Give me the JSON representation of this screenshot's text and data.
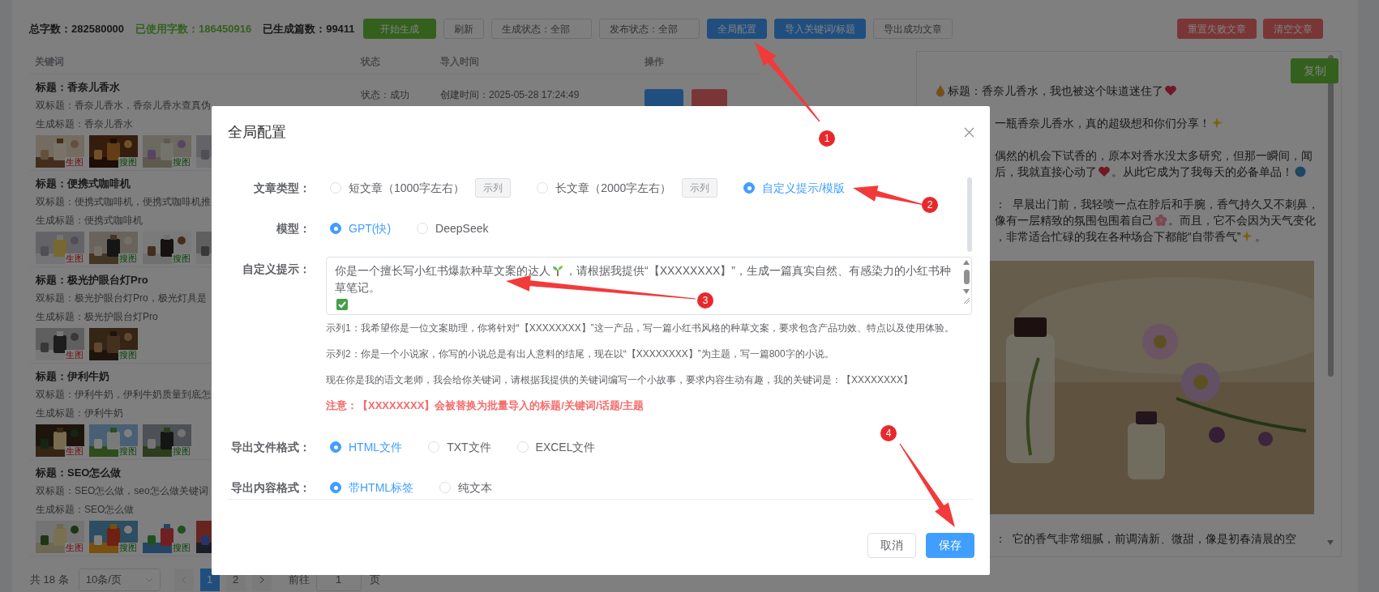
{
  "toolbar": {
    "stats": [
      {
        "text": "总字数：282580000",
        "kind": "plain"
      },
      {
        "text": "已使用字数：186450916",
        "kind": "highlight"
      },
      {
        "text": "已生成篇数：99411",
        "kind": "plain"
      }
    ],
    "buttons": [
      {
        "label": "开始生成",
        "kind": "success"
      },
      {
        "label": "刷新",
        "kind": "default"
      },
      {
        "label": "生成状态：全部",
        "kind": "select"
      },
      {
        "label": "发布状态：全部",
        "kind": "select"
      },
      {
        "label": "全局配置",
        "kind": "primary"
      },
      {
        "label": "导入关键词/标题",
        "kind": "primary"
      },
      {
        "label": "导出成功文章",
        "kind": "default"
      }
    ],
    "right_buttons": [
      {
        "label": "重置失败文章",
        "kind": "danger"
      },
      {
        "label": "清空文章",
        "kind": "danger"
      }
    ]
  },
  "table": {
    "columns": [
      "关键词",
      "状态",
      "导入时间",
      "操作"
    ],
    "rows": [
      {
        "title": "标题：香奈儿香水",
        "double_title": "双标题：香奈儿香水，香奈儿香水查真伪",
        "generated_title": "生成标题：香奈儿香水",
        "status": "状态：成功",
        "created": "创建时间：2025-05-28 17:24:49",
        "images": [
          {
            "kind": "generated",
            "badge": "生图"
          },
          {
            "kind": "searched",
            "badge": "搜图"
          },
          {
            "kind": "searched",
            "badge": "搜图"
          },
          {
            "kind": "picture"
          }
        ]
      },
      {
        "title": "标题：便携式咖啡机",
        "double_title": "双标题：便携式咖啡机，便携式咖啡机推",
        "generated_title": "生成标题：便携式咖啡机",
        "images": [
          {
            "kind": "generated",
            "badge": "生图"
          },
          {
            "kind": "searched",
            "badge": "搜图"
          },
          {
            "kind": "searched",
            "badge": "搜图"
          },
          {
            "kind": "picture"
          }
        ]
      },
      {
        "title": "标题：极光护眼台灯Pro",
        "double_title": "双标题：极光护眼台灯Pro，极光灯具是",
        "generated_title": "生成标题：极光护眼台灯Pro",
        "images": [
          {
            "kind": "generated",
            "badge": "生图"
          },
          {
            "kind": "searched",
            "badge": "搜图"
          }
        ]
      },
      {
        "title": "标题：伊利牛奶",
        "double_title": "双标题：伊利牛奶，伊利牛奶质量到底怎",
        "generated_title": "生成标题：伊利牛奶",
        "images": [
          {
            "kind": "generated",
            "badge": "生图"
          },
          {
            "kind": "searched",
            "badge": "搜图"
          },
          {
            "kind": "searched",
            "badge": "搜图"
          }
        ]
      },
      {
        "title": "标题：SEO怎么做",
        "double_title": "双标题：SEO怎么做，seo怎么做关键词",
        "generated_title": "生成标题：SEO怎么做",
        "images": [
          {
            "kind": "generated",
            "badge": "生图"
          },
          {
            "kind": "searched",
            "badge": "搜图"
          },
          {
            "kind": "searched",
            "badge": "搜图"
          },
          {
            "kind": "picture"
          }
        ]
      }
    ]
  },
  "pagination": {
    "total": "共 18 条",
    "page_size": "10条/页",
    "pages": [
      {
        "label": "1",
        "selected": true
      },
      {
        "label": "2",
        "selected": false
      }
    ],
    "goto_label": "前往",
    "goto_value": "1",
    "goto_suffix": "页"
  },
  "preview": {
    "copy_button": "复制",
    "paragraphs": [
      {
        "lines": [
          [
            {
              "kind": "drop"
            },
            {
              "kind": "text",
              "text": "标题：香奈儿香水，我也被这个味道迷住了"
            },
            {
              "kind": "heart"
            }
          ]
        ]
      },
      {
        "lines": [
          [
            {
              "kind": "text",
              "text": "一瓶香奈儿香水，真的超级想和你们分享！"
            },
            {
              "kind": "sparkle"
            }
          ]
        ]
      },
      {
        "lines": [
          [
            {
              "kind": "text",
              "text": "偶然的机会下试香的，原本对香水没太多研究，但那一瞬间，闻"
            }
          ],
          [
            {
              "kind": "text",
              "text": "后，我就直接心动了"
            },
            {
              "kind": "heart"
            },
            {
              "kind": "text",
              "text": "。从此它成为了我每天的必备单品！"
            },
            {
              "kind": "globe"
            }
          ]
        ]
      },
      {
        "lines": [
          [
            {
              "kind": "text",
              "text": "：  早晨出门前，我轻喷一点在脖后和手腕，香气持久又不刺鼻，"
            }
          ],
          [
            {
              "kind": "text",
              "text": "像有一层精致的氛围包围着自己"
            },
            {
              "kind": "flower"
            },
            {
              "kind": "text",
              "text": "。而且，它不会因为天气变化"
            }
          ],
          [
            {
              "kind": "text",
              "text": "，非常适合忙碌的我在各种场合下都能“自带香气”"
            },
            {
              "kind": "sparkle"
            },
            {
              "kind": "text",
              "text": "。"
            }
          ]
        ]
      }
    ],
    "after_image": "：  它的香气非常细腻，前调清新、微甜，像是初春清晨的空"
  },
  "modal": {
    "title": "全局配置",
    "sections": [
      {
        "kind": "radio",
        "label": "文章类型：",
        "options": [
          {
            "label": "短文章（1000字左右）",
            "selected": false,
            "tag": "示列"
          },
          {
            "label": "长文章（2000字左右）",
            "selected": false,
            "tag": "示列"
          },
          {
            "label": "自定义提示/模版",
            "selected": true
          }
        ]
      },
      {
        "kind": "radio",
        "label": "模型：",
        "options": [
          {
            "label": "GPT(快)",
            "selected": true
          },
          {
            "label": "DeepSeek",
            "selected": false
          }
        ]
      },
      {
        "kind": "textarea",
        "label": "自定义提示：",
        "parts": [
          {
            "kind": "text",
            "text": "你是一个擅长写小红书爆款种草文案的达人"
          },
          {
            "kind": "sprout"
          },
          {
            "kind": "text",
            "text": "，请根据我提供“【XXXXXXXX】”，生成一篇真实自然、有感染力的小红书种草笔记。"
          },
          {
            "kind": "break"
          },
          {
            "kind": "check"
          }
        ]
      },
      {
        "kind": "notes",
        "examples": [
          "示列1：我希望你是一位文案助理，你将针对“【XXXXXXXX】”这一产品，写一篇小红书风格的种草文案，要求包含产品功效、特点以及使用体验。",
          "示列2：你是一个小说家，你写的小说总是有出人意料的结尾，现在以“【XXXXXXXX】”为主题，写一篇800字的小说。",
          "现在你是我的语文老师，我会给你关键词，请根据我提供的关键词编写一个小故事，要求内容生动有趣，我的关键词是：【XXXXXXXX】"
        ],
        "warning": "注意：【XXXXXXXX】会被替换为批量导入的标题/关键词/话题/主题"
      },
      {
        "kind": "radio",
        "label": "导出文件格式：",
        "options": [
          {
            "label": "HTML文件",
            "selected": true
          },
          {
            "label": "TXT文件",
            "selected": false
          },
          {
            "label": "EXCEL文件",
            "selected": false
          }
        ]
      },
      {
        "kind": "radio",
        "label": "导出内容格式：",
        "options": [
          {
            "label": "带HTML标签",
            "selected": true
          },
          {
            "label": "纯文本",
            "selected": false
          }
        ]
      }
    ],
    "buttons": [
      {
        "label": "取消",
        "kind": "default"
      },
      {
        "label": "保存",
        "kind": "primary"
      }
    ]
  },
  "annotations": [
    {
      "number": "1"
    },
    {
      "number": "2"
    },
    {
      "number": "3"
    },
    {
      "number": "4"
    }
  ]
}
